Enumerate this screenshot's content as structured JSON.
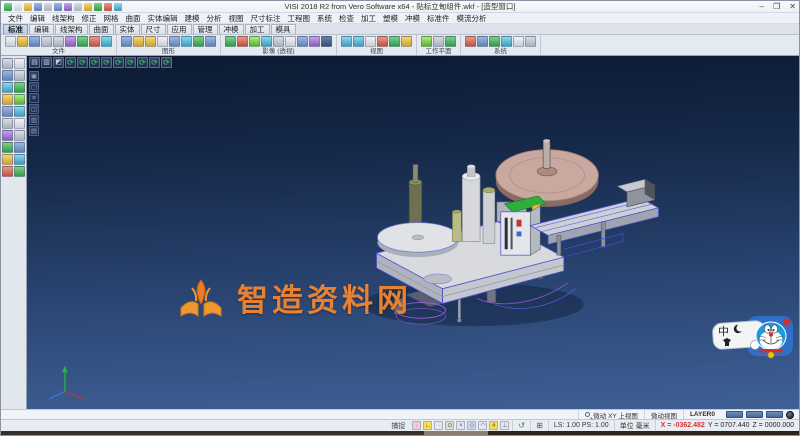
{
  "window": {
    "title": "VISI 2018 R2 from Vero Software x64 - 贴标立甸组件.wkf - [造型窗口]",
    "controls": {
      "minimize": "–",
      "maximize": "❐",
      "close": "✕"
    }
  },
  "menubar": {
    "items": [
      "文件",
      "编辑",
      "线架构",
      "修正",
      "网格",
      "曲面",
      "实体编辑",
      "建模",
      "分析",
      "视图",
      "尺寸标注",
      "工程图",
      "系统",
      "检查",
      "加工",
      "塑模",
      "冲模",
      "标准件",
      "模流分析"
    ]
  },
  "ribbon": {
    "tabs": [
      "标准",
      "编辑",
      "线架构",
      "曲面",
      "实体",
      "尺寸",
      "应用",
      "管理",
      "冲模",
      "加工",
      "模具"
    ],
    "selected_tab": "标准",
    "groups": [
      {
        "label": "文件"
      },
      {
        "label": "图形"
      },
      {
        "label": "影像 (透视)"
      },
      {
        "label": "视图"
      },
      {
        "label": "工作平面"
      },
      {
        "label": "系统"
      }
    ]
  },
  "viewport": {
    "watermark_text": "智造资料网",
    "ime_mode": "中"
  },
  "statusbar": {
    "view_mode": "微动 XY 上视图",
    "view_label": "微动视图",
    "layer": "LAYER0",
    "snap_label": "捕捉",
    "scale": "LS: 1.00 PS: 1.00",
    "units": "单位 毫米",
    "coord_x": "X = -0362.482",
    "coord_y": "Y = 0707.440",
    "coord_z": "Z = 0000.000"
  },
  "colors": {
    "viewport_top": "#0c1a33",
    "viewport_bottom": "#3f6096",
    "watermark": "#ef8430",
    "coord_x_alert": "#e03030",
    "base_plate": "#d8dade",
    "reel_disc": "#c9a8a0",
    "edge_blue": "#4a4ad4"
  }
}
